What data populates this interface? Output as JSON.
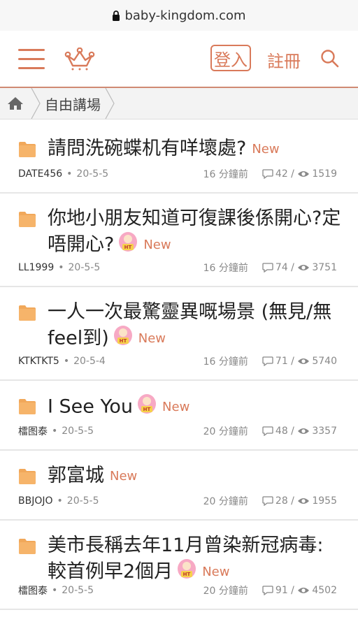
{
  "browser": {
    "url": "baby-kingdom.com"
  },
  "header": {
    "login_label": "登入",
    "register_label": "註冊"
  },
  "breadcrumb": {
    "section": "自由講場"
  },
  "colors": {
    "accent": "#d97a5a",
    "folder": "#f1a85a",
    "divider": "#e6e6e6"
  },
  "threads": [
    {
      "title": "請問洗碗蝶机有咩壞處?",
      "new_label": "New",
      "sticker": false,
      "author": "DATE456",
      "date": "20-5-5",
      "ago": "16 分鐘前",
      "replies": "42",
      "views": "1519"
    },
    {
      "title": "你地小朋友知道可復課後係開心?定唔開心?",
      "new_label": "New",
      "sticker": true,
      "author": "LL1999",
      "date": "20-5-5",
      "ago": "16 分鐘前",
      "replies": "74",
      "views": "3751"
    },
    {
      "title": "一人一次最驚靈異嘅場景 (無見/無feel到)",
      "new_label": "New",
      "sticker": true,
      "author": "KTKTKT5",
      "date": "20-5-4",
      "ago": "16 分鐘前",
      "replies": "71",
      "views": "5740"
    },
    {
      "title": "I See You",
      "new_label": "New",
      "sticker": true,
      "author": "檑图泰",
      "date": "20-5-5",
      "ago": "20 分鐘前",
      "replies": "48",
      "views": "3357"
    },
    {
      "title": "郭富城",
      "new_label": "New",
      "sticker": false,
      "author": "BBJOJO",
      "date": "20-5-5",
      "ago": "20 分鐘前",
      "replies": "28",
      "views": "1955"
    },
    {
      "title": "美市長稱去年11月曾染新冠病毒:較首例早2個月",
      "new_label": "New",
      "sticker": true,
      "author": "檑图泰",
      "date": "20-5-5",
      "ago": "20 分鐘前",
      "replies": "91",
      "views": "4502"
    }
  ]
}
